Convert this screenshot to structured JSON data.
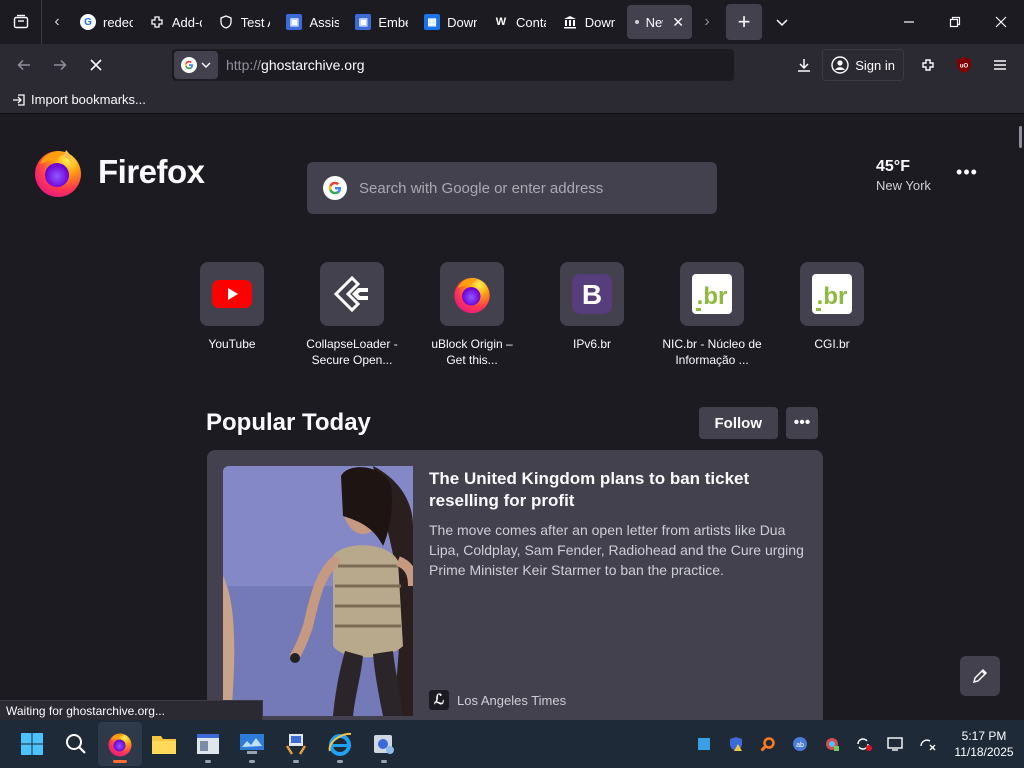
{
  "tabbar": {
    "tabs": [
      {
        "title": "redeca",
        "fav_color": "#1a73e8",
        "fav_glyph": "G"
      },
      {
        "title": "Add-ons",
        "fav_color": "#1c1b22",
        "fav_glyph": "⬚"
      },
      {
        "title": "Test Ads",
        "fav_color": "#1c1b22",
        "fav_glyph": "⛨"
      },
      {
        "title": "Assistant",
        "fav_color": "#3b6bd8",
        "fav_glyph": "▣"
      },
      {
        "title": "Embed",
        "fav_color": "#3b6bd8",
        "fav_glyph": "▣"
      },
      {
        "title": "Downloads",
        "fav_color": "#1a73e8",
        "fav_glyph": "▦"
      },
      {
        "title": "Contact",
        "fav_color": "#1c1b22",
        "fav_glyph": "W"
      },
      {
        "title": "Download",
        "fav_color": "#1c1b22",
        "fav_glyph": "🏛"
      }
    ],
    "active_tab": {
      "title": "New Tab"
    }
  },
  "navbar": {
    "url_scheme": "http://",
    "url_host": "ghostarchive.org",
    "sign_in": "Sign in"
  },
  "bookmarks": {
    "import": "Import bookmarks..."
  },
  "newtab": {
    "logo_text": "Firefox",
    "search_placeholder": "Search with Google or enter address",
    "weather": {
      "temp": "45°F",
      "city": "New York"
    },
    "shortcuts": [
      {
        "label": "YouTube",
        "icon": "youtube-icon"
      },
      {
        "label": "CollapseLoader - Secure Open...",
        "icon": "collapseloader-icon"
      },
      {
        "label": "uBlock Origin – Get this...",
        "icon": "firefox-icon"
      },
      {
        "label": "IPv6.br",
        "icon": "bootstrap-icon"
      },
      {
        "label": "NIC.br - Núcleo de Informação ...",
        "icon": "nicbr-icon"
      },
      {
        "label": "CGI.br",
        "icon": "cgibr-icon"
      }
    ],
    "popular": {
      "title": "Popular Today",
      "follow": "Follow",
      "card": {
        "title": "The United Kingdom plans to ban ticket reselling for profit",
        "description": "The move comes after an open letter from artists like Dua Lipa, Coldplay, Sam Fender, Radiohead and the Cure urging Prime Minister Keir Starmer to ban the practice.",
        "source": "Los Angeles Times"
      }
    },
    "status": "Waiting for ghostarchive.org..."
  },
  "taskbar": {
    "time": "5:17 PM",
    "date": "11/18/2025"
  }
}
